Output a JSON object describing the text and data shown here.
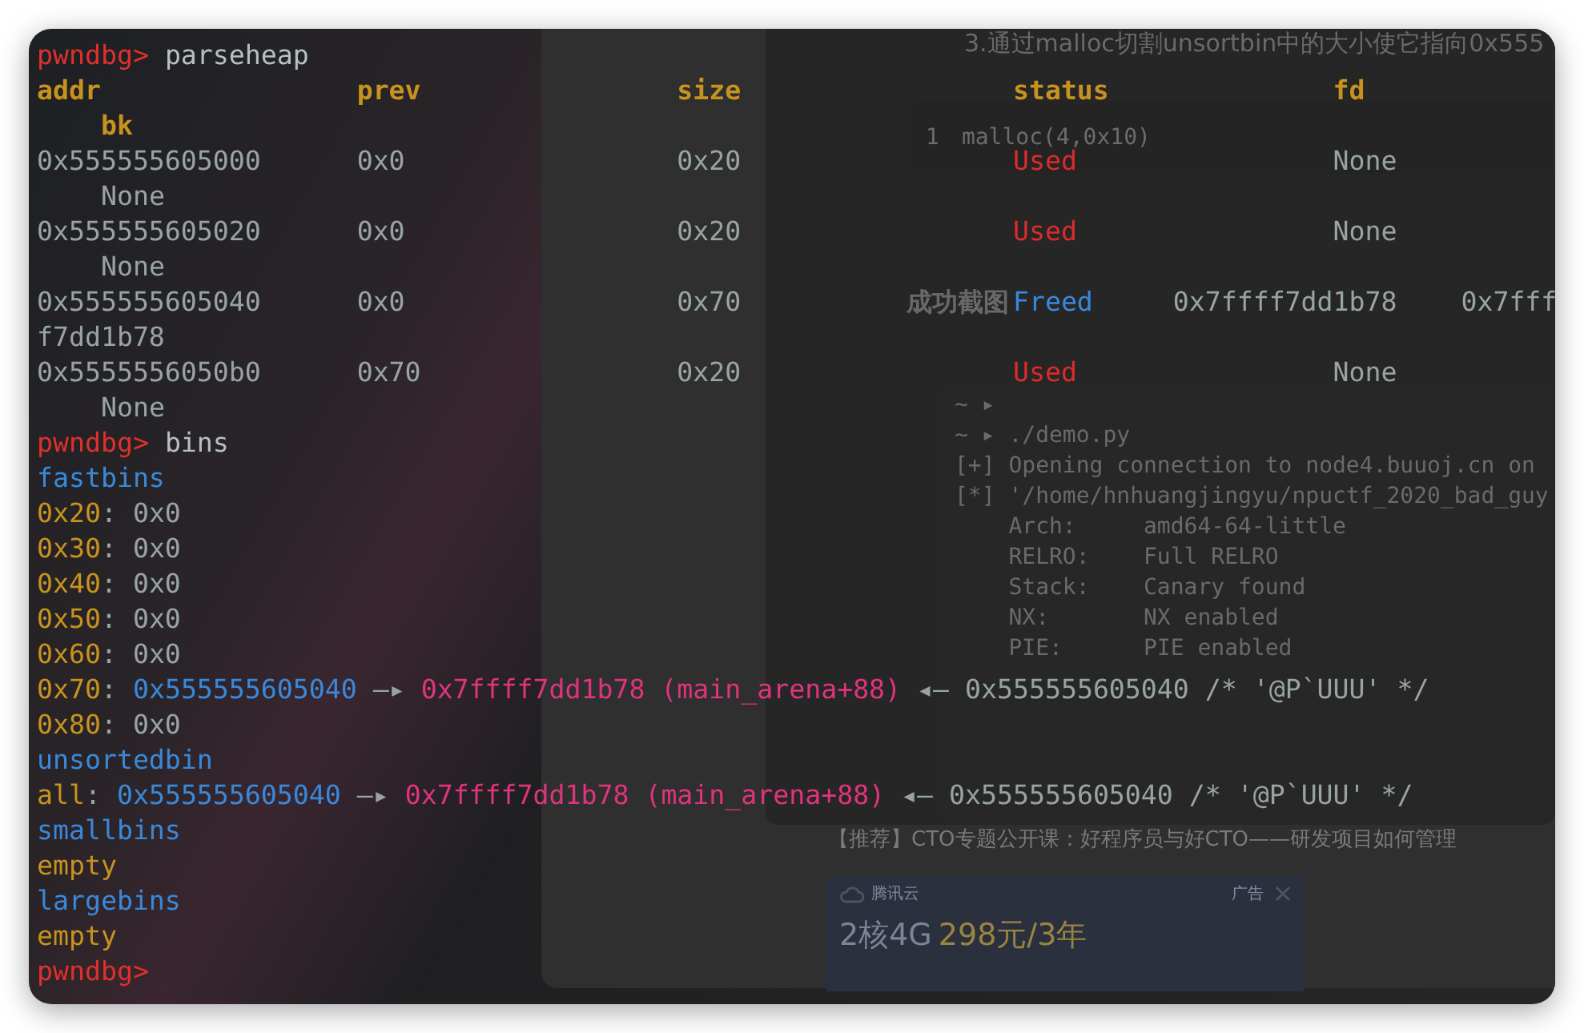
{
  "background_window": {
    "article_heading": "3.通过malloc切割unsortbin中的大小使它指向0x555",
    "code_line_number": "1",
    "code_snippet": "malloc(4,0x10)",
    "section_heading": "成功截图",
    "screenshot_lines": [
      "~ ▸",
      "~ ▸ ./demo.py",
      "[+] Opening connection to node4.buuoj.cn on",
      "[*] '/home/hnhuangjingyu/npuctf_2020_bad_guy",
      "    Arch:     amd64-64-little",
      "    RELRO:    Full RELRO",
      "    Stack:    Canary found",
      "    NX:       NX enabled",
      "    PIE:      PIE enabled"
    ],
    "recommendation_link": "【推荐】CTO专题公开课：好程序员与好CTO——研发项目如何管理",
    "ad": {
      "brand": "腾讯云",
      "label": "广告",
      "headline_main": "2核4G",
      "headline_price": "298元/3年"
    }
  },
  "terminal": {
    "lines": [
      {
        "segments": [
          {
            "text": "pwndbg>",
            "kind": "prompt"
          },
          {
            "text": " parseheap",
            "kind": "command"
          }
        ]
      },
      {
        "segments": [
          {
            "text": "addr                ",
            "kind": "header"
          },
          {
            "text": "prev                ",
            "kind": "header"
          },
          {
            "text": "size                 ",
            "kind": "header"
          },
          {
            "text": "status              ",
            "kind": "header"
          },
          {
            "text": "fd",
            "kind": "header"
          }
        ]
      },
      {
        "segments": [
          {
            "text": "    bk",
            "kind": "header"
          }
        ]
      },
      {
        "segments": [
          {
            "text": "0x555555605000      ",
            "kind": "plain"
          },
          {
            "text": "0x0                 ",
            "kind": "plain"
          },
          {
            "text": "0x20                 ",
            "kind": "plain"
          },
          {
            "text": "Used                ",
            "kind": "used"
          },
          {
            "text": "None",
            "kind": "plain"
          }
        ]
      },
      {
        "segments": [
          {
            "text": "    None",
            "kind": "plain"
          }
        ]
      },
      {
        "segments": [
          {
            "text": "0x555555605020      ",
            "kind": "plain"
          },
          {
            "text": "0x0                 ",
            "kind": "plain"
          },
          {
            "text": "0x20                 ",
            "kind": "plain"
          },
          {
            "text": "Used                ",
            "kind": "used"
          },
          {
            "text": "None",
            "kind": "plain"
          }
        ]
      },
      {
        "segments": [
          {
            "text": "    None",
            "kind": "plain"
          }
        ]
      },
      {
        "segments": [
          {
            "text": "0x555555605040      ",
            "kind": "plain"
          },
          {
            "text": "0x0                 ",
            "kind": "plain"
          },
          {
            "text": "0x70                 ",
            "kind": "plain"
          },
          {
            "text": "Freed     ",
            "kind": "freed"
          },
          {
            "text": "0x7ffff7dd1b78    ",
            "kind": "plain"
          },
          {
            "text": "0x7fff",
            "kind": "plain"
          }
        ]
      },
      {
        "segments": [
          {
            "text": "f7dd1b78",
            "kind": "plain"
          }
        ]
      },
      {
        "segments": [
          {
            "text": "0x5555556050b0      ",
            "kind": "plain"
          },
          {
            "text": "0x70                ",
            "kind": "plain"
          },
          {
            "text": "0x20                 ",
            "kind": "plain"
          },
          {
            "text": "Used                ",
            "kind": "used"
          },
          {
            "text": "None",
            "kind": "plain"
          }
        ]
      },
      {
        "segments": [
          {
            "text": "    None",
            "kind": "plain"
          }
        ]
      },
      {
        "segments": [
          {
            "text": "pwndbg>",
            "kind": "prompt"
          },
          {
            "text": " bins",
            "kind": "command"
          }
        ]
      },
      {
        "segments": [
          {
            "text": "fastbins",
            "kind": "section"
          }
        ]
      },
      {
        "segments": [
          {
            "text": "0x20",
            "kind": "key"
          },
          {
            "text": ": 0x0",
            "kind": "plain"
          }
        ]
      },
      {
        "segments": [
          {
            "text": "0x30",
            "kind": "key"
          },
          {
            "text": ": 0x0",
            "kind": "plain"
          }
        ]
      },
      {
        "segments": [
          {
            "text": "0x40",
            "kind": "key"
          },
          {
            "text": ": 0x0",
            "kind": "plain"
          }
        ]
      },
      {
        "segments": [
          {
            "text": "0x50",
            "kind": "key"
          },
          {
            "text": ": 0x0",
            "kind": "plain"
          }
        ]
      },
      {
        "segments": [
          {
            "text": "0x60",
            "kind": "key"
          },
          {
            "text": ": 0x0",
            "kind": "plain"
          }
        ]
      },
      {
        "segments": [
          {
            "text": "0x70",
            "kind": "key"
          },
          {
            "text": ": ",
            "kind": "plain"
          },
          {
            "text": "0x555555605040",
            "kind": "section"
          },
          {
            "text": " —▸ ",
            "kind": "plain"
          },
          {
            "text": "0x7ffff7dd1b78 (main_arena+88)",
            "kind": "symbol"
          },
          {
            "text": " ◂— 0x555555605040 /* '@P`UUU' */",
            "kind": "plain"
          }
        ]
      },
      {
        "segments": [
          {
            "text": "0x80",
            "kind": "key"
          },
          {
            "text": ": 0x0",
            "kind": "plain"
          }
        ]
      },
      {
        "segments": [
          {
            "text": "unsortedbin",
            "kind": "section"
          }
        ]
      },
      {
        "segments": [
          {
            "text": "all",
            "kind": "key"
          },
          {
            "text": ": ",
            "kind": "plain"
          },
          {
            "text": "0x555555605040",
            "kind": "section"
          },
          {
            "text": " —▸ ",
            "kind": "plain"
          },
          {
            "text": "0x7ffff7dd1b78 (main_arena+88)",
            "kind": "symbol"
          },
          {
            "text": " ◂— 0x555555605040 /* '@P`UUU' */",
            "kind": "plain"
          }
        ]
      },
      {
        "segments": [
          {
            "text": "smallbins",
            "kind": "section"
          }
        ]
      },
      {
        "segments": [
          {
            "text": "empty",
            "kind": "key"
          }
        ]
      },
      {
        "segments": [
          {
            "text": "largebins",
            "kind": "section"
          }
        ]
      },
      {
        "segments": [
          {
            "text": "empty",
            "kind": "key"
          }
        ]
      },
      {
        "segments": [
          {
            "text": "pwndbg>",
            "kind": "prompt"
          }
        ]
      }
    ]
  }
}
